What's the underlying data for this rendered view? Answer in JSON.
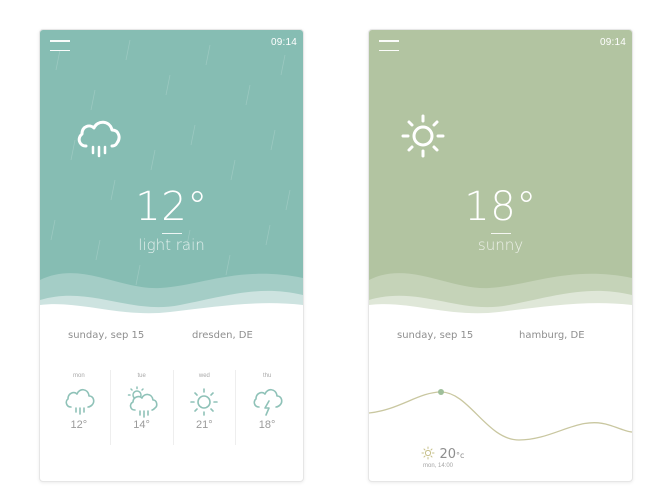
{
  "colors": {
    "rain_accent": "#86bdb3",
    "sun_accent": "#b2c4a1",
    "graph_line": "#c9c7a0"
  },
  "rain_card": {
    "time": "09:14",
    "temperature": "12°",
    "condition": "light rain",
    "date": "sunday, sep 15",
    "location": "dresden, DE",
    "main_icon": "cloud-rain-icon",
    "forecast": [
      {
        "day": "mon",
        "temp": "12°",
        "icon": "cloud-rain-icon"
      },
      {
        "day": "tue",
        "temp": "14°",
        "icon": "sun-cloud-rain-icon"
      },
      {
        "day": "wed",
        "temp": "21°",
        "icon": "sun-icon"
      },
      {
        "day": "thu",
        "temp": "18°",
        "icon": "cloud-lightning-icon"
      }
    ]
  },
  "sun_card": {
    "time": "09:14",
    "temperature": "18°",
    "condition": "sunny",
    "date": "sunday, sep 15",
    "location": "hamburg, DE",
    "main_icon": "sun-icon",
    "graph_readout": {
      "temp_value": "20",
      "temp_unit": "°c",
      "when": "mon, 14:00"
    }
  }
}
